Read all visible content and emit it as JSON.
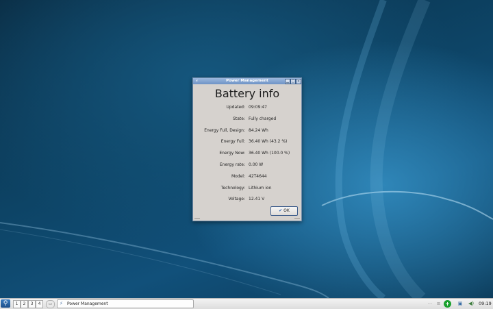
{
  "window": {
    "title": "Power Management",
    "heading": "Battery info",
    "controls": {
      "minimize": "▁",
      "maximize": "□",
      "close": "×"
    }
  },
  "battery": [
    {
      "label": "Updated:",
      "value": "09:09:47"
    },
    {
      "label": "State:",
      "value": "Fully charged"
    },
    {
      "label": "Energy Full, Design:",
      "value": "84.24 Wh"
    },
    {
      "label": "Energy Full:",
      "value": "36.40 Wh (43.2 %)"
    },
    {
      "label": "Energy Now:",
      "value": "36.40 Wh (100.0 %)"
    },
    {
      "label": "Energy rate:",
      "value": "0.00 W"
    },
    {
      "label": "Model:",
      "value": "42T4644"
    },
    {
      "label": "Technology:",
      "value": "Lithium ion"
    },
    {
      "label": "Voltage:",
      "value": "12.41 V"
    }
  ],
  "ok_button": {
    "label": "OK",
    "icon": "✔"
  },
  "taskbar": {
    "workspaces": [
      "1",
      "2",
      "3",
      "4"
    ],
    "task_label": "Power Management",
    "clock": "09:19"
  },
  "icons": {
    "start": "search-icon",
    "task": "battery-app-icon",
    "tray": [
      "tray-dots-icon",
      "tray-lines-icon",
      "update-icon",
      "network-icon",
      "volume-icon"
    ]
  },
  "colors": {
    "titlebar": "#7f9fd0",
    "dialog_bg": "#d6d2ce",
    "update_green": "#1aa12e"
  }
}
